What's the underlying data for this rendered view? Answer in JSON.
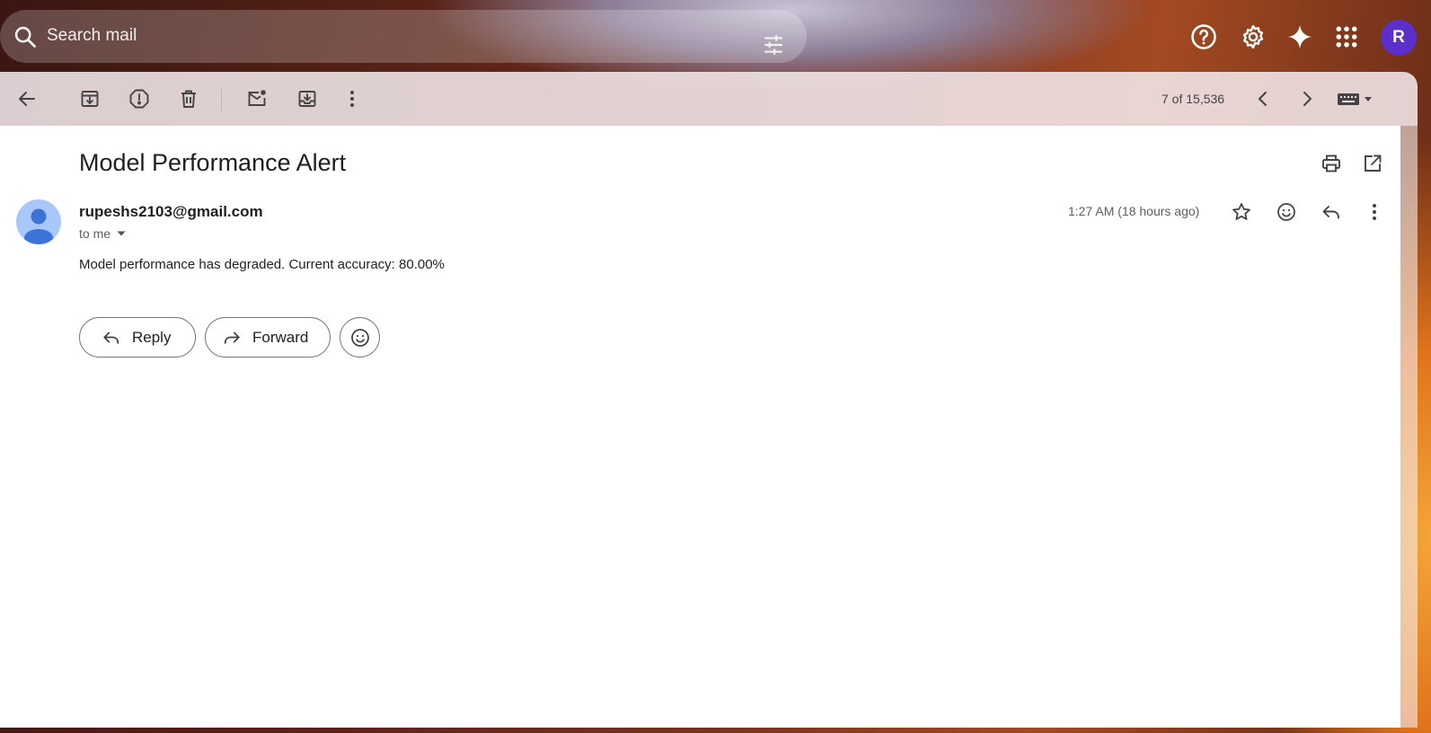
{
  "search": {
    "placeholder": "Search mail"
  },
  "account": {
    "initial": "R"
  },
  "toolbar": {
    "counter": "7 of 15,536"
  },
  "message": {
    "subject": "Model Performance Alert",
    "sender": "rupeshs2103@gmail.com",
    "recipient_label": "to me",
    "time": "1:27 AM (18 hours ago)",
    "body": "Model performance has degraded. Current accuracy: 80.00%"
  },
  "actions": {
    "reply": "Reply",
    "forward": "Forward"
  }
}
